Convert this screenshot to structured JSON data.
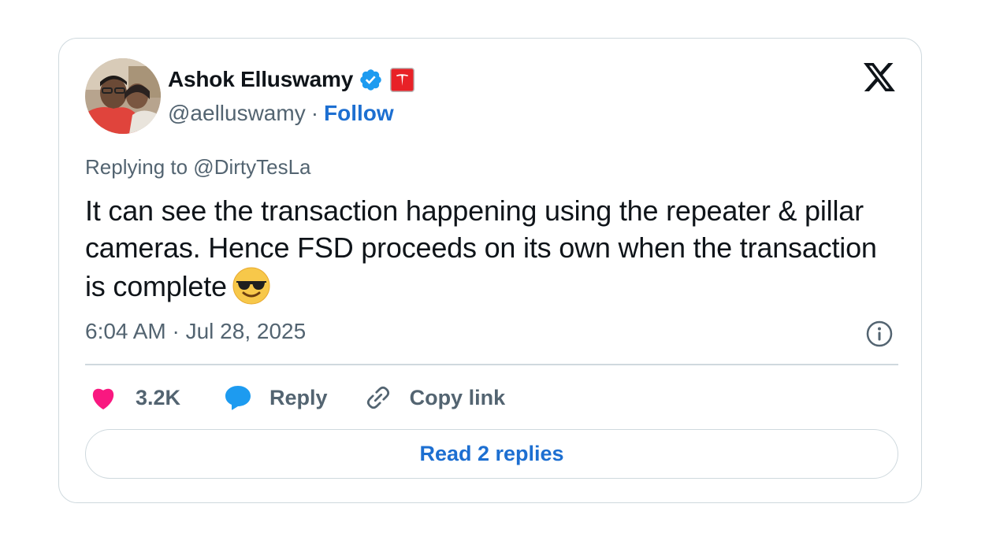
{
  "author": {
    "display_name": "Ashok Elluswamy",
    "handle": "@aelluswamy",
    "separator": "·",
    "follow_label": "Follow",
    "verified_icon": "verified-badge-icon",
    "affiliate_icon": "tesla-logo-icon"
  },
  "platform_icon": "x-logo-icon",
  "tweet": {
    "replying_to": "Replying to @DirtyTesLa",
    "text": "It can see the transaction happening using the repeater & pillar cameras. Hence FSD proceeds on its own when the transaction is complete",
    "emoji": "smiling-face-with-sunglasses",
    "timestamp": "6:04 AM · Jul 28, 2025"
  },
  "actions": {
    "like_count": "3.2K",
    "reply_label": "Reply",
    "copy_link_label": "Copy link"
  },
  "read_replies_label": "Read 2 replies",
  "colors": {
    "link": "#1d6fd1",
    "muted_text": "#536471",
    "like": "#f91880",
    "reply_bubble": "#1d9bf0",
    "verified": "#1d9bf0",
    "border": "#cfd9de",
    "tesla_badge": "#e82127"
  }
}
